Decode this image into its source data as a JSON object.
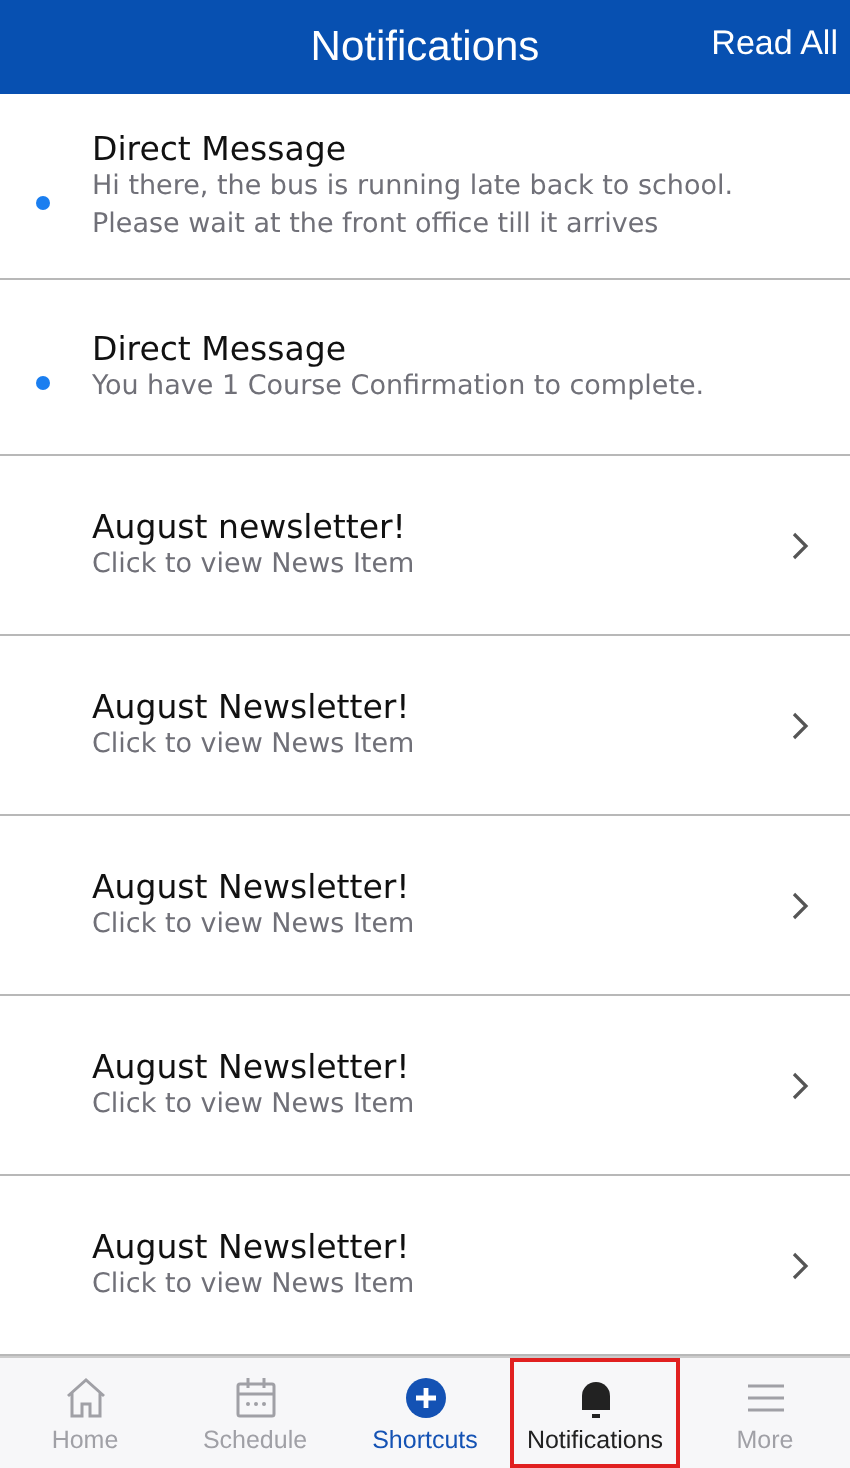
{
  "header": {
    "title": "Notifications",
    "action": "Read All"
  },
  "notifications": [
    {
      "kind": "message",
      "unread": true,
      "title": "Direct Message",
      "body": "Hi there, the bus is running late back to school. Please wait at the front office till it arrives"
    },
    {
      "kind": "message",
      "unread": true,
      "title": "Direct Message",
      "body": "You have 1 Course Confirmation to complete."
    },
    {
      "kind": "news",
      "unread": false,
      "title": "August newsletter!",
      "body": "Click to view News Item"
    },
    {
      "kind": "news",
      "unread": false,
      "title": "August Newsletter!",
      "body": "Click to view News Item"
    },
    {
      "kind": "news",
      "unread": false,
      "title": "August Newsletter!",
      "body": "Click to view News Item"
    },
    {
      "kind": "news",
      "unread": false,
      "title": "August Newsletter!",
      "body": "Click to view News Item"
    },
    {
      "kind": "news",
      "unread": false,
      "title": "August Newsletter!",
      "body": "Click to view News Item"
    }
  ],
  "tabs": [
    {
      "kind": "home",
      "label": "Home",
      "selected": false,
      "accent": false,
      "highlighted": false
    },
    {
      "kind": "schedule",
      "label": "Schedule",
      "selected": false,
      "accent": false,
      "highlighted": false
    },
    {
      "kind": "shortcuts",
      "label": "Shortcuts",
      "selected": false,
      "accent": true,
      "highlighted": false
    },
    {
      "kind": "notifications",
      "label": "Notifications",
      "selected": true,
      "accent": false,
      "highlighted": true
    },
    {
      "kind": "more",
      "label": "More",
      "selected": false,
      "accent": false,
      "highlighted": false
    }
  ]
}
